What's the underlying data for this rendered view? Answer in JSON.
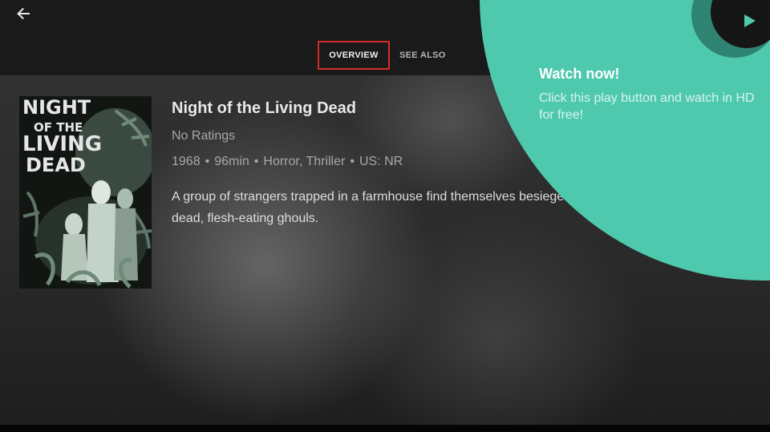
{
  "header": {
    "back_icon": "arrow-left-icon",
    "tabs": [
      {
        "label": "OVERVIEW",
        "active": true
      },
      {
        "label": "SEE ALSO",
        "active": false
      }
    ]
  },
  "movie": {
    "poster_title_lines": [
      "NIGHT",
      "OF THE",
      "LIVING",
      "DEAD"
    ],
    "title": "Night of the Living Dead",
    "rating": "No Ratings",
    "year": "1968",
    "duration": "96min",
    "genres": "Horror, Thriller",
    "certification": "US: NR",
    "separator": "•",
    "description": "A group of strangers trapped in a farmhouse find themselves besieged by the recently dead, flesh-eating ghouls."
  },
  "tutorial": {
    "title": "Watch now!",
    "body": "Click this play button and watch in HD for free!",
    "play_icon": "play-icon",
    "accent_color": "#4fc9ae"
  }
}
